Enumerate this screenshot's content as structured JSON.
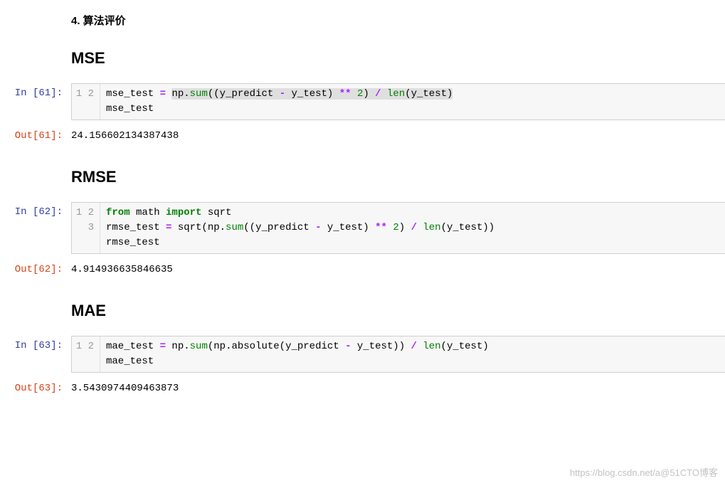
{
  "section_title": "4. 算法评价",
  "sections": [
    {
      "heading": "MSE",
      "in_prompt": "In  [61]:",
      "out_prompt": "Out[61]:",
      "line_numbers": [
        "1",
        "2"
      ],
      "code_html": "mse_test <span class=\"tok-op\">=</span> <span class=\"hl-span\">np.<span class=\"tok-builtin\">sum</span>((y_predict <span class=\"tok-op\">-</span> y_test) <span class=\"tok-op\">**</span> <span class=\"tok-num\">2</span>) <span class=\"tok-op\">/</span> <span class=\"tok-builtin\">len</span>(y_test)</span>\nmse_test",
      "output": "24.156602134387438"
    },
    {
      "heading": "RMSE",
      "in_prompt": "In  [62]:",
      "out_prompt": "Out[62]:",
      "line_numbers": [
        "1",
        "2",
        "3"
      ],
      "code_html": "<span class=\"tok-kw\">from</span> math <span class=\"tok-kw\">import</span> sqrt\nrmse_test <span class=\"tok-op\">=</span> sqrt(np.<span class=\"tok-builtin\">sum</span>((y_predict <span class=\"tok-op\">-</span> y_test) <span class=\"tok-op\">**</span> <span class=\"tok-num\">2</span>) <span class=\"tok-op\">/</span> <span class=\"tok-builtin\">len</span>(y_test))\nrmse_test",
      "output": "4.914936635846635"
    },
    {
      "heading": "MAE",
      "in_prompt": "In  [63]:",
      "out_prompt": "Out[63]:",
      "line_numbers": [
        "1",
        "2"
      ],
      "code_html": "mae_test <span class=\"tok-op\">=</span> np.<span class=\"tok-builtin\">sum</span>(np.absolute(y_predict <span class=\"tok-op\">-</span> y_test)) <span class=\"tok-op\">/</span> <span class=\"tok-builtin\">len</span>(y_test)\nmae_test",
      "output": "3.5430974409463873"
    }
  ],
  "watermark": "https://blog.csdn.net/a@51CTO博客"
}
